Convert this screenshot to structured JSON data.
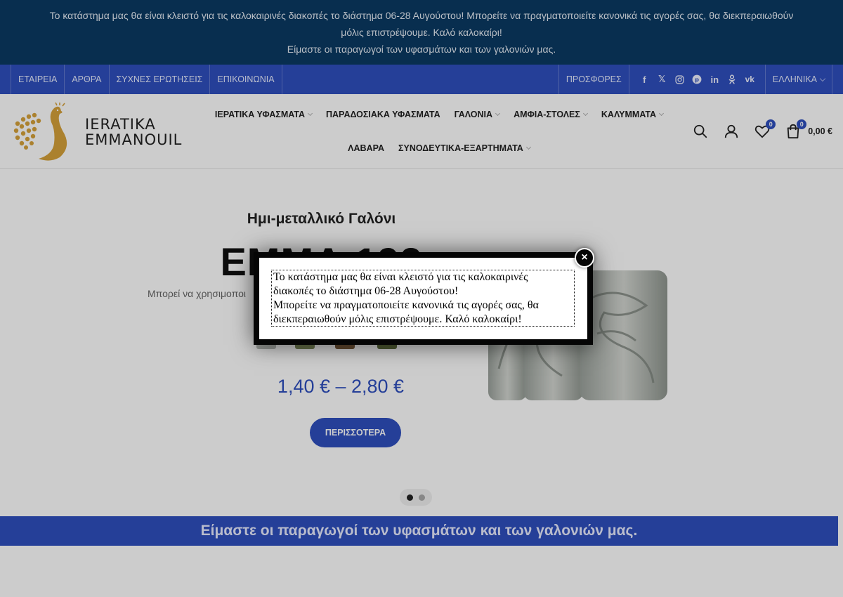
{
  "notice": {
    "line1": "Το κατάστημα μας θα είναι κλειστό για τις καλοκαιρινές διακοπές το διάστημα 06-28 Αυγούστου! Μπορείτε να πραγματοποιείτε κανονικά τις αγορές σας, θα διεκπεραιωθούν",
    "line2": "μόλις επιστρέψουμε. Καλό καλοκαίρι!",
    "line3": "Είμαστε οι παραγωγοί των υφασμάτων και των γαλονιών μας."
  },
  "topbar": {
    "left_links": [
      "ΕΤΑΙΡΕΙΑ",
      "ΑΡΘΡΑ",
      "ΣΥΧΝΕΣ ΕΡΩΤΗΣΕΙΣ",
      "ΕΠΙΚΟΙΝΩΝΙΑ"
    ],
    "offers": "ΠΡΟΣΦΟΡΕΣ",
    "socials": [
      "facebook-icon",
      "x-icon",
      "instagram-icon",
      "pinterest-icon",
      "linkedin-icon",
      "odnoklassniki-icon",
      "vk-icon"
    ],
    "language": "ΕΛΛΗΝΙΚΑ"
  },
  "logo": {
    "line1": "IERATIKA",
    "line2": "EMMANOUIL",
    "color": "#d6a23a"
  },
  "nav": {
    "row1": [
      "ΙΕΡΑΤΙΚΑ ΥΦΑΣΜΑΤΑ",
      "ΠΑΡΑΔΟΣΙΑΚΑ ΥΦΑΣΜΑΤΑ",
      "ΓΑΛΟΝΙΑ",
      "ΑΜΦΙΑ-ΣΤΟΛΕΣ",
      "ΚΑΛΥΜΜΑΤΑ"
    ],
    "row2": [
      "ΛΑΒΑΡΑ",
      "ΣΥΝΟΔΕΥΤΙΚΑ-ΕΞΑΡΤΗΜΑΤΑ"
    ]
  },
  "header_icons": {
    "wishlist_count": "0",
    "cart_count": "0",
    "cart_total": "0,00 €"
  },
  "hero": {
    "subtitle": "Ημι-μεταλλικό Γαλόνι",
    "title": "ΕΜΜΑ 192",
    "description": "Μπορεί να χρησιμοποι",
    "price": "1,40 € – 2,80 €",
    "button": "ΠΕΡΙΣΣΟΤΕΡΑ"
  },
  "strip": {
    "text": "Είμαστε οι παραγωγοί των υφασμάτων και των γαλονιών μας."
  },
  "modal": {
    "line1": "Το κατάστημα μας θα είναι κλειστό για τις καλοκαιρινές",
    "line2": "διακοπές το διάστημα 06-28 Αυγούστου!",
    "line3": "Μπορείτε να πραγματοποιείτε κανονικά τις αγορές σας, θα",
    "line4": "διεκπεραιωθούν μόλις επιστρέψουμε. Καλό καλοκαίρι!",
    "close_symbol": "×"
  },
  "colors": {
    "brand_blue": "#2f4fbf",
    "notice_bg": "#0b3a63"
  }
}
